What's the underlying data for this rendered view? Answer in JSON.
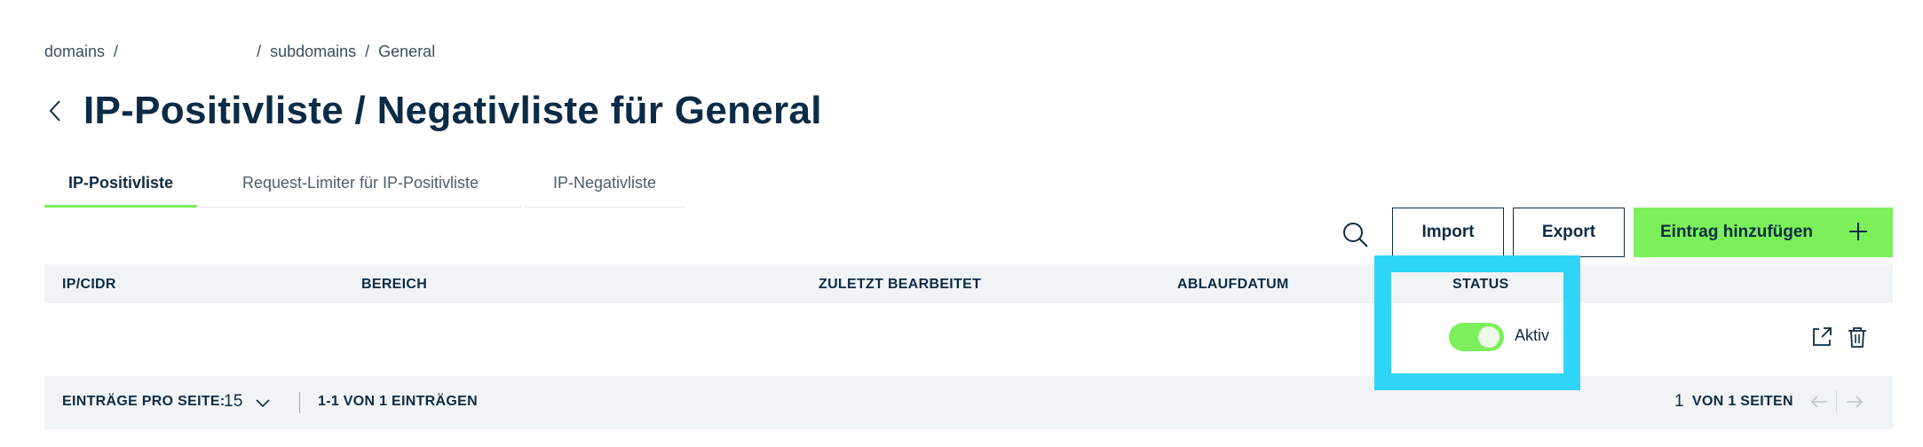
{
  "breadcrumb": {
    "first": "domains",
    "sep": "/",
    "second": "subdomains",
    "third": "General"
  },
  "page": {
    "title": "IP-Positivliste / Negativliste für General"
  },
  "tabs": [
    {
      "label": "IP-Positivliste",
      "active": true
    },
    {
      "label": "Request-Limiter für IP-Positivliste",
      "active": false
    },
    {
      "label": "IP-Negativliste",
      "active": false
    }
  ],
  "toolbar": {
    "import_label": "Import",
    "export_label": "Export",
    "add_label": "Eintrag hinzufügen"
  },
  "table": {
    "columns": [
      "IP/CIDR",
      "BEREICH",
      "ZULETZT BEARBEITET",
      "ABLAUFDATUM",
      "STATUS"
    ],
    "rows": [
      {
        "ip": "",
        "bereich": "",
        "zuletzt": "",
        "ablauf": "",
        "status": "Aktiv",
        "status_on": true
      }
    ]
  },
  "footer": {
    "perpage_label": "EINTRÄGE PRO SEITE:",
    "perpage_value": "15",
    "range": "1-1 VON 1 EINTRÄGEN",
    "page_number": "1",
    "page_of": "VON 1 SEITEN"
  },
  "colors": {
    "accent": "#7cf05a",
    "text": "#0d2b45",
    "header_bg": "#f1f4f7",
    "highlight": "#2fd5f7"
  },
  "icons": [
    "chevron-left-icon",
    "search-icon",
    "plus-icon",
    "external-link-icon",
    "trash-icon",
    "chevron-down-icon",
    "arrow-left-icon",
    "arrow-right-icon"
  ]
}
